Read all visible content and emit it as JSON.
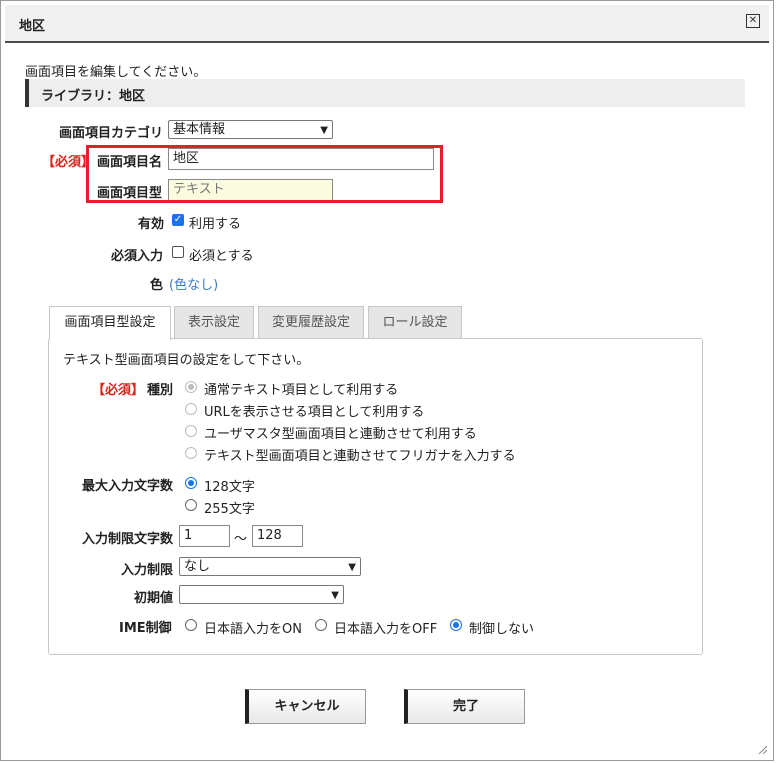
{
  "dialog": {
    "title": "地区",
    "close_icon": "close-icon",
    "intro": "画面項目を編集してください。",
    "library_bar": "ライブラリ：地区"
  },
  "form": {
    "category_label": "画面項目カテゴリ",
    "category_value": "基本情報",
    "required_tag": "【必須】",
    "name_label": "画面項目名",
    "name_value": "地区",
    "type_label": "画面項目型",
    "type_value": "テキスト",
    "enabled_label": "有効",
    "enabled_checkbox_label": "利用する",
    "enabled_checked": true,
    "required_input_label": "必須入力",
    "required_input_checkbox_label": "必須とする",
    "required_input_checked": false,
    "color_label": "色",
    "color_value": "(色なし)"
  },
  "tabs": [
    {
      "label": "画面項目型設定",
      "active": true
    },
    {
      "label": "表示設定",
      "active": false
    },
    {
      "label": "変更履歴設定",
      "active": false
    },
    {
      "label": "ロール設定",
      "active": false
    }
  ],
  "panel": {
    "description": "テキスト型画面項目の設定をして下さい。",
    "kind_required_tag": "【必須】",
    "kind_label": "種別",
    "kind_options": [
      "通常テキスト項目として利用する",
      "URLを表示させる項目として利用する",
      "ユーザマスタ型画面項目と連動させて利用する",
      "テキスト型画面項目と連動させてフリガナを入力する"
    ],
    "kind_selected_index": 0,
    "max_length_label": "最大入力文字数",
    "max_length_options": [
      "128文字",
      "255文字"
    ],
    "max_length_selected_index": 0,
    "limit_range_label": "入力制限文字数",
    "limit_min": "1",
    "limit_separator": "～",
    "limit_max": "128",
    "input_restriction_label": "入力制限",
    "input_restriction_value": "なし",
    "initial_value_label": "初期値",
    "initial_value_value": "",
    "ime_label": "IME制御",
    "ime_options": [
      "日本語入力をON",
      "日本語入力をOFF",
      "制御しない"
    ],
    "ime_selected_index": 2
  },
  "buttons": {
    "cancel": "キャンセル",
    "done": "完了"
  },
  "colors": {
    "required_red": "#d9261c",
    "highlight_box": "#e0202a",
    "accent_blue": "#1a73e8",
    "link_blue": "#3a7cc4"
  }
}
